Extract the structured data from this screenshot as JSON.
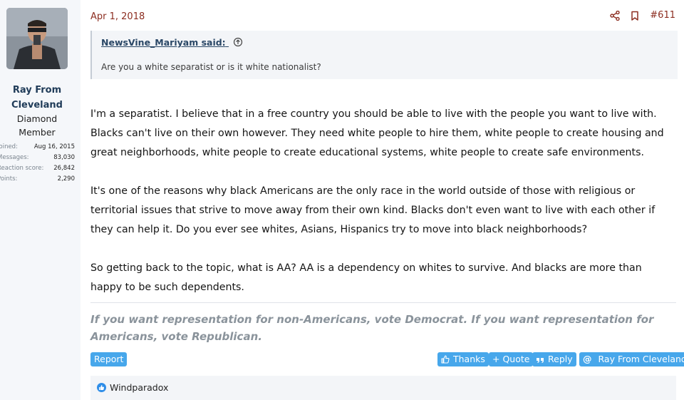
{
  "user": {
    "name_line1": "Ray From",
    "name_line2": "Cleveland",
    "title_line1": "Diamond",
    "title_line2": "Member",
    "stats": [
      {
        "key": "Joined:",
        "value": "Aug 16, 2015"
      },
      {
        "key": "Messages:",
        "value": "83,030"
      },
      {
        "key": "Reaction score:",
        "value": "26,842"
      },
      {
        "key": "Points:",
        "value": "2,290"
      }
    ]
  },
  "post": {
    "date": "Apr 1, 2018",
    "number": "#611",
    "quote": {
      "author": "NewsVine_Mariyam said:",
      "text": "Are you a white separatist or is it white nationalist?"
    },
    "paragraphs": [
      "I'm a separatist. I believe that in a free country you should be able to live with the people you want to live with. Blacks can't live on their own however. They need white people to hire them, white people to create housing and great neighborhoods, white people to create educational systems, white people to create safe environments.",
      "It's one of the reasons why black Americans are the only race in the world outside of those with religious or territorial issues that strive to move away from their own kind. Blacks don't even want to live with each other if they can help it. Do you ever see whites, Asians, Hispanics try to move into black neighborhoods?",
      "So getting back to the topic, what is AA? AA is a dependency on whites to survive. And blacks are more than happy to be such dependents."
    ],
    "signature": "If you want representation for non-Americans, vote Democrat. If you want representation for Americans, vote Republican."
  },
  "footer": {
    "report": "Report",
    "thanks": "Thanks",
    "quote": "+ Quote",
    "reply": "Reply",
    "mention": "Ray From Cleveland"
  },
  "reactions": {
    "names": "Windparadox"
  },
  "colors": {
    "accent": "#47a7eb",
    "date": "#8c2d20",
    "username": "#1f3b58"
  },
  "icons": [
    "share-icon",
    "bookmark-icon",
    "quote-up-arrow-icon",
    "thumbs-up-icon",
    "quote-mark-icon",
    "at-icon",
    "like-reaction-icon"
  ]
}
